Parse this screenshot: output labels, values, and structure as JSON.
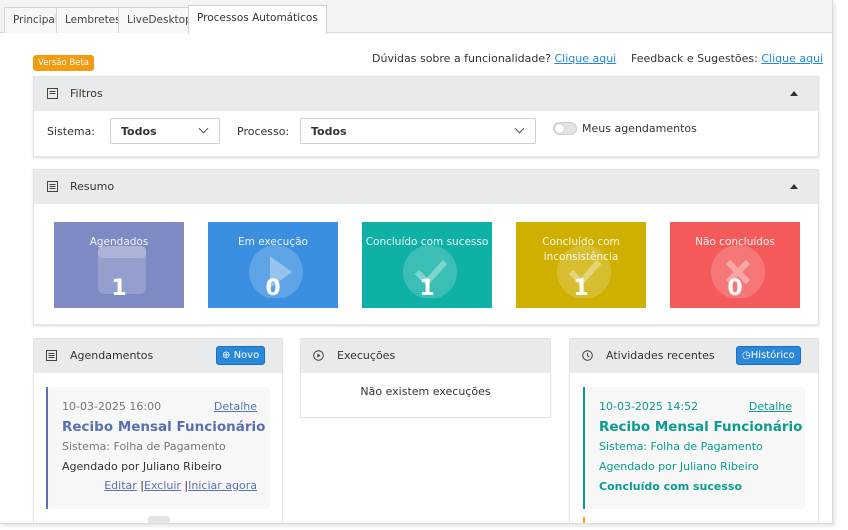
{
  "tabs": [
    {
      "label": "Principal"
    },
    {
      "label": "Lembretes"
    },
    {
      "label": "LiveDesktop"
    },
    {
      "label": "Processos Automáticos"
    }
  ],
  "beta_label": "Versão Beta",
  "help": {
    "question": "Dúvidas sobre a funcionalidade? ",
    "question_link": "Clique aqui",
    "feedback": "Feedback e Sugestões: ",
    "feedback_link": "Clique aqui"
  },
  "filters": {
    "title": "Filtros",
    "sistema_label": "Sistema:",
    "sistema_value": "Todos",
    "processo_label": "Processo:",
    "processo_value": "Todos",
    "toggle_label": "Meus agendamentos"
  },
  "summary": {
    "title": "Resumo",
    "cards": [
      {
        "title": "Agendados",
        "value": "1",
        "color": "#7f89c4",
        "icon": "calendar-icon"
      },
      {
        "title": "Em execução",
        "value": "0",
        "color": "#3a8fe0",
        "icon": "play-icon"
      },
      {
        "title": "Concluído com sucesso",
        "value": "1",
        "color": "#0fb0a6",
        "icon": "check-icon"
      },
      {
        "title": "Concluído com inconsistência",
        "value": "1",
        "color": "#cfb000",
        "icon": "check-icon"
      },
      {
        "title": "Não concluídos",
        "value": "0",
        "color": "#f55a5a",
        "icon": "x-icon"
      }
    ]
  },
  "agendamentos": {
    "title": "Agendamentos",
    "new_button": "Novo",
    "item": {
      "date": "10-03-2025 16:00",
      "detail": "Detalhe",
      "name": "Recibo Mensal Funcionário",
      "system": "Sistema: Folha de Pagamento",
      "by": "Agendado por Juliano Ribeiro",
      "edit": "Editar",
      "delete": "Excluir",
      "start": "Iniciar agora"
    }
  },
  "execucoes": {
    "title": "Execuções",
    "empty": "Não existem execuções"
  },
  "atividades": {
    "title": "Atividades recentes",
    "history_button": "Histórico",
    "item": {
      "date": "10-03-2025 14:52",
      "detail": "Detalhe",
      "name": "Recibo Mensal Funcionário",
      "system": "Sistema: Folha de Pagamento",
      "by": "Agendado por Juliano Ribeiro",
      "status": "Concluído com sucesso"
    }
  },
  "colors": {
    "accent_blue": "#2a88d8",
    "agendamento_accent": "#5a6fb3",
    "success_teal": "#0a9c8f"
  }
}
